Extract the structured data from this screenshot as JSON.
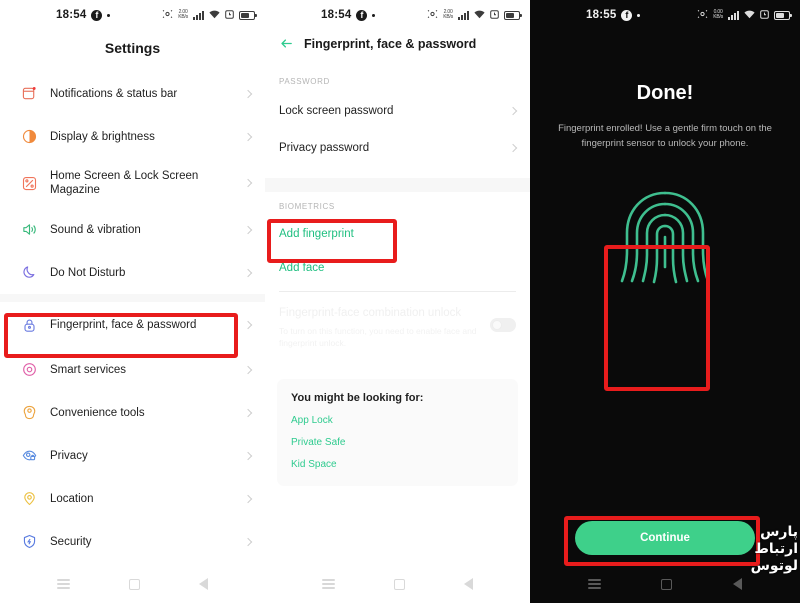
{
  "screens": {
    "settings": {
      "statusbar": {
        "time": "18:54",
        "fb_glyph": "f",
        "icons": [
          "nfc-icon",
          "network-speed-icon",
          "signal-icon",
          "wifi-icon",
          "alarm-icon",
          "battery-icon"
        ],
        "speed_top": "2.00",
        "speed_bottom": "KB/s"
      },
      "title": "Settings",
      "items": [
        {
          "label": "Notifications & status bar",
          "icon": "notifications-icon",
          "color": "#e8705a"
        },
        {
          "label": "Display & brightness",
          "icon": "brightness-icon",
          "color": "#f08a3c"
        },
        {
          "label": "Home Screen & Lock Screen Magazine",
          "icon": "home-screen-icon",
          "color": "#f0745a"
        },
        {
          "label": "Sound & vibration",
          "icon": "sound-icon",
          "color": "#37b87a"
        },
        {
          "label": "Do Not Disturb",
          "icon": "moon-icon",
          "color": "#7b6fe0"
        },
        {
          "label": "Fingerprint, face & password",
          "icon": "lock-icon",
          "color": "#6a7be0"
        },
        {
          "label": "Smart services",
          "icon": "smart-services-icon",
          "color": "#e060a8"
        },
        {
          "label": "Convenience tools",
          "icon": "convenience-tools-icon",
          "color": "#eca440"
        },
        {
          "label": "Privacy",
          "icon": "privacy-eye-icon",
          "color": "#5a8ce0"
        },
        {
          "label": "Location",
          "icon": "location-pin-icon",
          "color": "#ecc040"
        },
        {
          "label": "Security",
          "icon": "security-shield-icon",
          "color": "#5a7ce0"
        }
      ]
    },
    "fingerprint_page": {
      "statusbar": {
        "time": "18:54",
        "fb_glyph": "f",
        "speed_top": "2.00",
        "speed_bottom": "KB/s"
      },
      "title": "Fingerprint, face & password",
      "back_icon": "back-arrow-icon",
      "password_group": "PASSWORD",
      "password_items": [
        {
          "label": "Lock screen password"
        },
        {
          "label": "Privacy password"
        }
      ],
      "biometrics_group": "BIOMETRICS",
      "biometrics_items": [
        {
          "label": "Add fingerprint"
        },
        {
          "label": "Add face"
        }
      ],
      "combination": {
        "title": "Fingerprint-face combination unlock",
        "subtitle": "To turn on this function, you need to enable face and fingerprint unlock.",
        "toggle_state": "off"
      },
      "suggestions": {
        "heading": "You might be looking for:",
        "links": [
          "App Lock",
          "Private Safe",
          "Kid Space"
        ]
      }
    },
    "done_screen": {
      "statusbar": {
        "time": "18:55",
        "fb_glyph": "f",
        "speed_top": "0.00",
        "speed_bottom": "KB/s"
      },
      "title": "Done!",
      "subtitle": "Fingerprint enrolled! Use a gentle firm touch on the fingerprint sensor to unlock your phone.",
      "fingerprint_icon": "fingerprint-icon",
      "continue_label": "Continue"
    }
  },
  "navbar": {
    "items": [
      {
        "icon": "recents-icon"
      },
      {
        "icon": "home-icon"
      },
      {
        "icon": "back-icon"
      }
    ]
  },
  "annotations": {
    "color": "#e81c1c",
    "boxes": [
      {
        "name": "highlight-fingerprint-settings-row"
      },
      {
        "name": "highlight-add-fingerprint"
      },
      {
        "name": "highlight-fingerprint-graphic"
      },
      {
        "name": "highlight-continue-button"
      }
    ]
  },
  "watermark": {
    "line1": "پارس",
    "line2": "ارتباط",
    "line3": "لوتوس"
  },
  "colors": {
    "accent_green": "#2fcb8f",
    "button_green": "#3ed08a",
    "annotation_red": "#e81c1c",
    "dark_bg": "#0a0a0a"
  }
}
